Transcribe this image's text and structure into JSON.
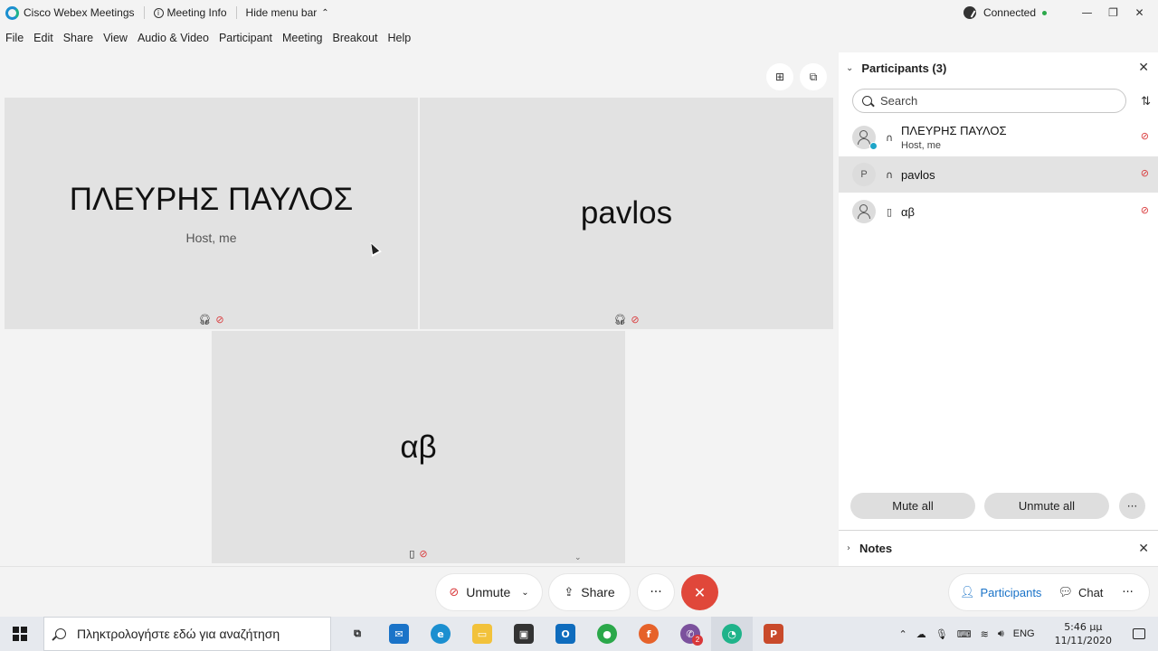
{
  "titlebar": {
    "app_name": "Cisco Webex Meetings",
    "meeting_info": "Meeting Info",
    "hide_menu_bar": "Hide menu bar",
    "connection_status": "Connected",
    "status_color": "#2ba84a"
  },
  "menu": [
    "File",
    "Edit",
    "Share",
    "View",
    "Audio & Video",
    "Participant",
    "Meeting",
    "Breakout",
    "Help"
  ],
  "stage": {
    "tiles": [
      {
        "name": "ΠΛΕΥΡΗΣ ΠΑΥΛΟΣ",
        "subtitle": "Host, me"
      },
      {
        "name": "pavlos",
        "subtitle": ""
      },
      {
        "name": "αβ",
        "subtitle": ""
      }
    ]
  },
  "participants_panel": {
    "title": "Participants (3)",
    "search_placeholder": "Search",
    "items": [
      {
        "name": "ΠΛΕΥΡΗΣ ΠΑΥΛΟΣ",
        "subtitle": "Host, me",
        "avatar": "person-icon",
        "device": "headset-icon"
      },
      {
        "name": "pavlos",
        "subtitle": "",
        "avatar_letter": "P",
        "device": "headset-icon"
      },
      {
        "name": "αβ",
        "subtitle": "",
        "avatar": "person-icon",
        "device": "phone-icon"
      }
    ],
    "mute_all": "Mute all",
    "unmute_all": "Unmute all",
    "notes_title": "Notes"
  },
  "controls": {
    "unmute": "Unmute",
    "share": "Share",
    "participants": "Participants",
    "chat": "Chat",
    "leave_color": "#e0473a"
  },
  "taskbar": {
    "search_text": "Πληκτρολογήστε εδώ για αναζήτηση",
    "language": "ENG",
    "time": "5:46 μμ",
    "date": "11/11/2020",
    "viber_badge": "2"
  }
}
